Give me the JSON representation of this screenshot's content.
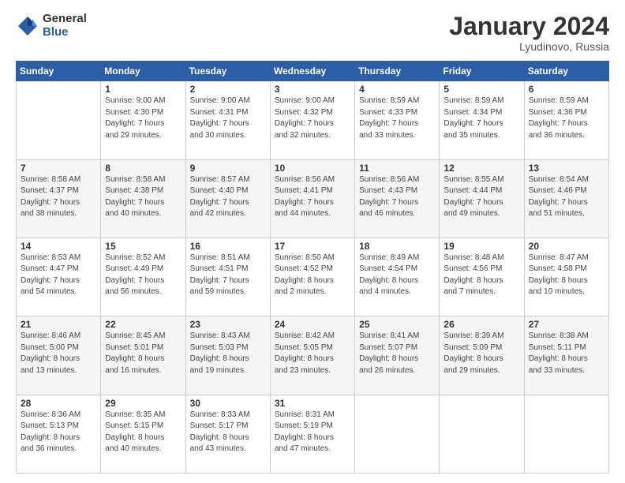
{
  "header": {
    "logo_general": "General",
    "logo_blue": "Blue",
    "month_title": "January 2024",
    "location": "Lyudinovo, Russia"
  },
  "days_of_week": [
    "Sunday",
    "Monday",
    "Tuesday",
    "Wednesday",
    "Thursday",
    "Friday",
    "Saturday"
  ],
  "weeks": [
    [
      {
        "day": "",
        "info": ""
      },
      {
        "day": "1",
        "info": "Sunrise: 9:00 AM\nSunset: 4:30 PM\nDaylight: 7 hours\nand 29 minutes."
      },
      {
        "day": "2",
        "info": "Sunrise: 9:00 AM\nSunset: 4:31 PM\nDaylight: 7 hours\nand 30 minutes."
      },
      {
        "day": "3",
        "info": "Sunrise: 9:00 AM\nSunset: 4:32 PM\nDaylight: 7 hours\nand 32 minutes."
      },
      {
        "day": "4",
        "info": "Sunrise: 8:59 AM\nSunset: 4:33 PM\nDaylight: 7 hours\nand 33 minutes."
      },
      {
        "day": "5",
        "info": "Sunrise: 8:59 AM\nSunset: 4:34 PM\nDaylight: 7 hours\nand 35 minutes."
      },
      {
        "day": "6",
        "info": "Sunrise: 8:59 AM\nSunset: 4:36 PM\nDaylight: 7 hours\nand 36 minutes."
      }
    ],
    [
      {
        "day": "7",
        "info": "Sunrise: 8:58 AM\nSunset: 4:37 PM\nDaylight: 7 hours\nand 38 minutes."
      },
      {
        "day": "8",
        "info": "Sunrise: 8:58 AM\nSunset: 4:38 PM\nDaylight: 7 hours\nand 40 minutes."
      },
      {
        "day": "9",
        "info": "Sunrise: 8:57 AM\nSunset: 4:40 PM\nDaylight: 7 hours\nand 42 minutes."
      },
      {
        "day": "10",
        "info": "Sunrise: 8:56 AM\nSunset: 4:41 PM\nDaylight: 7 hours\nand 44 minutes."
      },
      {
        "day": "11",
        "info": "Sunrise: 8:56 AM\nSunset: 4:43 PM\nDaylight: 7 hours\nand 46 minutes."
      },
      {
        "day": "12",
        "info": "Sunrise: 8:55 AM\nSunset: 4:44 PM\nDaylight: 7 hours\nand 49 minutes."
      },
      {
        "day": "13",
        "info": "Sunrise: 8:54 AM\nSunset: 4:46 PM\nDaylight: 7 hours\nand 51 minutes."
      }
    ],
    [
      {
        "day": "14",
        "info": "Sunrise: 8:53 AM\nSunset: 4:47 PM\nDaylight: 7 hours\nand 54 minutes."
      },
      {
        "day": "15",
        "info": "Sunrise: 8:52 AM\nSunset: 4:49 PM\nDaylight: 7 hours\nand 56 minutes."
      },
      {
        "day": "16",
        "info": "Sunrise: 8:51 AM\nSunset: 4:51 PM\nDaylight: 7 hours\nand 59 minutes."
      },
      {
        "day": "17",
        "info": "Sunrise: 8:50 AM\nSunset: 4:52 PM\nDaylight: 8 hours\nand 2 minutes."
      },
      {
        "day": "18",
        "info": "Sunrise: 8:49 AM\nSunset: 4:54 PM\nDaylight: 8 hours\nand 4 minutes."
      },
      {
        "day": "19",
        "info": "Sunrise: 8:48 AM\nSunset: 4:56 PM\nDaylight: 8 hours\nand 7 minutes."
      },
      {
        "day": "20",
        "info": "Sunrise: 8:47 AM\nSunset: 4:58 PM\nDaylight: 8 hours\nand 10 minutes."
      }
    ],
    [
      {
        "day": "21",
        "info": "Sunrise: 8:46 AM\nSunset: 5:00 PM\nDaylight: 8 hours\nand 13 minutes."
      },
      {
        "day": "22",
        "info": "Sunrise: 8:45 AM\nSunset: 5:01 PM\nDaylight: 8 hours\nand 16 minutes."
      },
      {
        "day": "23",
        "info": "Sunrise: 8:43 AM\nSunset: 5:03 PM\nDaylight: 8 hours\nand 19 minutes."
      },
      {
        "day": "24",
        "info": "Sunrise: 8:42 AM\nSunset: 5:05 PM\nDaylight: 8 hours\nand 23 minutes."
      },
      {
        "day": "25",
        "info": "Sunrise: 8:41 AM\nSunset: 5:07 PM\nDaylight: 8 hours\nand 26 minutes."
      },
      {
        "day": "26",
        "info": "Sunrise: 8:39 AM\nSunset: 5:09 PM\nDaylight: 8 hours\nand 29 minutes."
      },
      {
        "day": "27",
        "info": "Sunrise: 8:38 AM\nSunset: 5:11 PM\nDaylight: 8 hours\nand 33 minutes."
      }
    ],
    [
      {
        "day": "28",
        "info": "Sunrise: 8:36 AM\nSunset: 5:13 PM\nDaylight: 8 hours\nand 36 minutes."
      },
      {
        "day": "29",
        "info": "Sunrise: 8:35 AM\nSunset: 5:15 PM\nDaylight: 8 hours\nand 40 minutes."
      },
      {
        "day": "30",
        "info": "Sunrise: 8:33 AM\nSunset: 5:17 PM\nDaylight: 8 hours\nand 43 minutes."
      },
      {
        "day": "31",
        "info": "Sunrise: 8:31 AM\nSunset: 5:19 PM\nDaylight: 8 hours\nand 47 minutes."
      },
      {
        "day": "",
        "info": ""
      },
      {
        "day": "",
        "info": ""
      },
      {
        "day": "",
        "info": ""
      }
    ]
  ]
}
